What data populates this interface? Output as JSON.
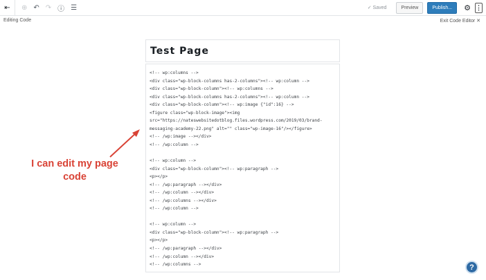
{
  "toolbar": {
    "back_icon": "⇤",
    "add_icon": "⊕",
    "undo_icon": "↶",
    "redo_icon": "↷",
    "info_icon": "ⓘ",
    "outline_icon": "☰",
    "saved": "✓ Saved",
    "preview": "Preview",
    "publish": "Publish...",
    "gear_icon": "⚙",
    "more_icon": "⋮"
  },
  "header": {
    "editing": "Editing Code",
    "exit": "Exit Code Editor ✕"
  },
  "page": {
    "title": "Test Page"
  },
  "code": [
    "<!-- wp:columns -->",
    "<div class=\"wp-block-columns has-2-columns\"><!-- wp:column -->",
    "<div class=\"wp-block-column\"><!-- wp:columns -->",
    "<div class=\"wp-block-columns has-2-columns\"><!-- wp:column -->",
    "<div class=\"wp-block-column\"><!-- wp:image {\"id\":16} -->",
    "<figure class=\"wp-block-image\"><img",
    "src=\"https://nateswebsitedotblog.files.wordpress.com/2019/03/brand-",
    "messaging-academy-22.png\" alt=\"\" class=\"wp-image-16\"/></figure>",
    "<!-- /wp:image --></div>",
    "<!-- /wp:column -->",
    "",
    "<!-- wp:column -->",
    "<div class=\"wp-block-column\"><!-- wp:paragraph -->",
    "<p></p>",
    "<!-- /wp:paragraph --></div>",
    "<!-- /wp:column --></div>",
    "<!-- /wp:columns --></div>",
    "<!-- /wp:column -->",
    "",
    "<!-- wp:column -->",
    "<div class=\"wp-block-column\"><!-- wp:paragraph -->",
    "<p></p>",
    "<!-- /wp:paragraph --></div>",
    "<!-- /wp:column --></div>",
    "<!-- /wp:columns -->"
  ],
  "annotation": {
    "line1": "I can edit my page",
    "line2": "code"
  },
  "help_icon": "?"
}
